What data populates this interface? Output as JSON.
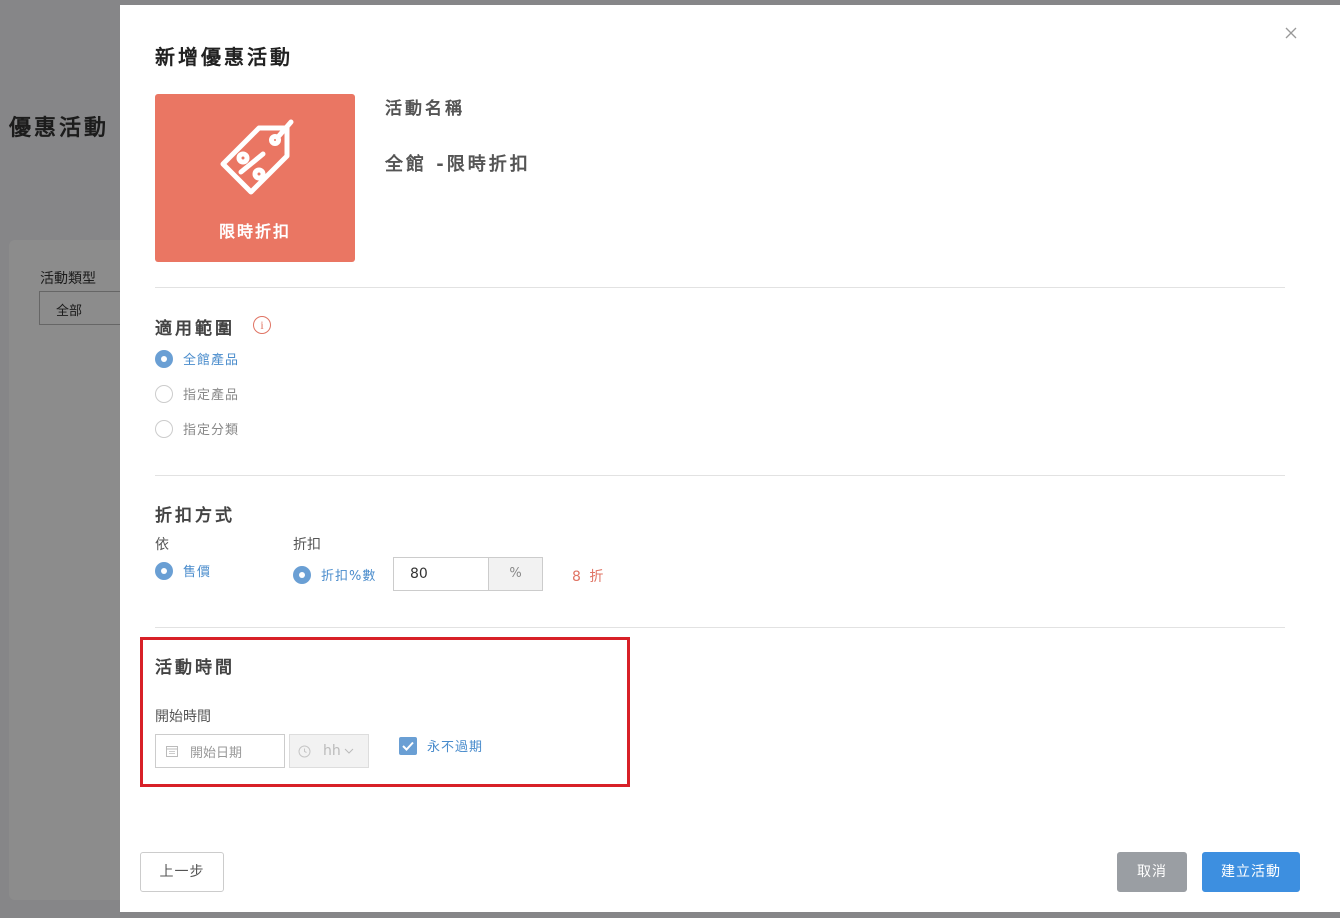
{
  "background": {
    "page_title": "優惠活動",
    "filter_label": "活動類型",
    "filter_value": "全部"
  },
  "modal": {
    "title": "新增優惠活動",
    "close_icon": "close-icon",
    "promo_card": {
      "icon": "discount-tag-icon",
      "label": "限時折扣",
      "color": "#ea7663"
    },
    "name_label": "活動名稱",
    "name_value": "全館 -限時折扣",
    "scope": {
      "title": "適用範圍",
      "info_icon": "i",
      "options": [
        {
          "label": "全館產品",
          "checked": true
        },
        {
          "label": "指定產品",
          "checked": false
        },
        {
          "label": "指定分類",
          "checked": false
        }
      ]
    },
    "discount": {
      "title": "折扣方式",
      "by_label": "依",
      "by_option": "售價",
      "discount_label": "折扣",
      "discount_option": "折扣%數",
      "value": "80",
      "unit": "%",
      "result": "8 折"
    },
    "time": {
      "title": "活動時間",
      "start_label": "開始時間",
      "date_placeholder": "開始日期",
      "hour_placeholder": "hh",
      "never_expire_label": "永不過期",
      "never_expire_checked": true
    },
    "buttons": {
      "prev": "上一步",
      "cancel": "取消",
      "create": "建立活動"
    }
  },
  "colors": {
    "accent": "#4a8ccc",
    "primary_button": "#3d8fe0",
    "cancel_button": "#9a9ea3",
    "highlight": "#d82028",
    "discount_text": "#e07464"
  }
}
